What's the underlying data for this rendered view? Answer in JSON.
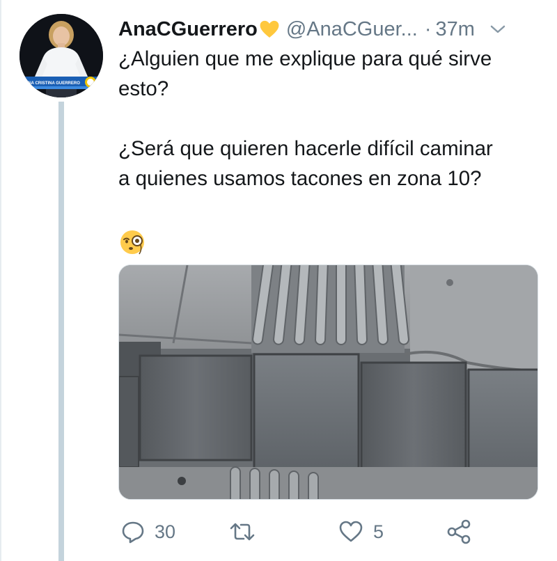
{
  "tweet": {
    "author": {
      "display_name": "AnaCGuerrero",
      "handle": "@AnaCGuer...",
      "badge_icon": "yellow-heart-icon",
      "avatar_caption": "ANA CRISTINA GUERRERO"
    },
    "separator": "·",
    "time": "37m",
    "text": "¿Alguien que me explique para qué sirve\nesto?\n\n¿Será que quieren hacerle difícil caminar\na quienes usamos tacones en zona 10?",
    "emoji_icon": "face-with-monocle-icon",
    "media_alt": "sidewalk-tactile-paving-photo"
  },
  "actions": {
    "reply": {
      "icon": "reply-icon",
      "count": "30"
    },
    "retweet": {
      "icon": "retweet-icon",
      "count": ""
    },
    "like": {
      "icon": "heart-icon",
      "count": "5"
    },
    "share": {
      "icon": "share-icon"
    }
  },
  "colors": {
    "text": "#14171a",
    "secondary": "#657786",
    "thread_line": "#c4d3dc",
    "badge_yellow": "#ffc83d"
  }
}
